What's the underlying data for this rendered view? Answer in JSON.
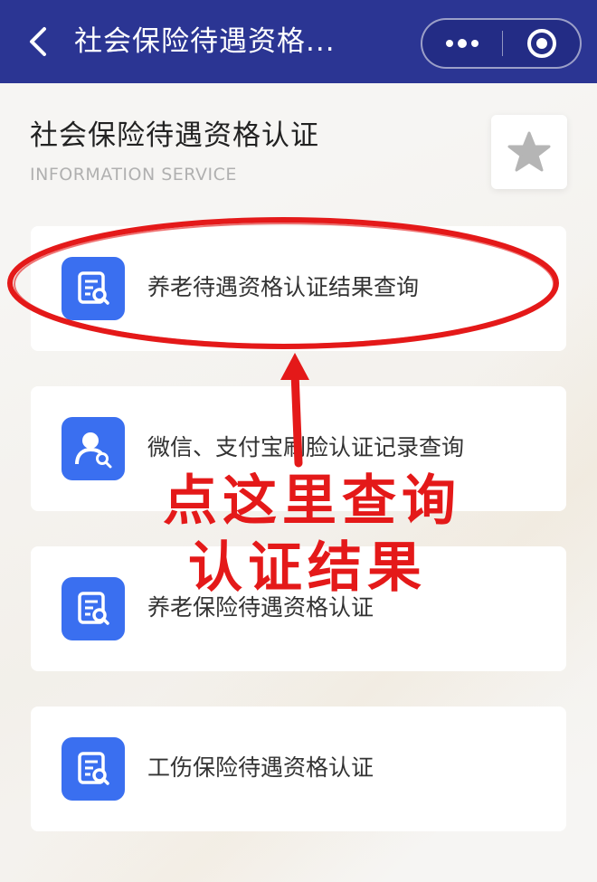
{
  "header": {
    "title": "社会保险待遇资格...",
    "back_icon": "chevron-left-icon",
    "more_icon": "more-dots-icon",
    "close_icon": "target-circle-icon",
    "background_color": "#2b3593"
  },
  "page": {
    "title": "社会保险待遇资格认证",
    "subtitle": "INFORMATION SERVICE",
    "favorite_icon": "star-icon"
  },
  "services": [
    {
      "label": "养老待遇资格认证结果查询",
      "icon": "document-search-icon"
    },
    {
      "label": "微信、支付宝刷脸认证记录查询",
      "icon": "user-search-icon"
    },
    {
      "label": "养老保险待遇资格认证",
      "icon": "document-search-icon"
    },
    {
      "label": "工伤保险待遇资格认证",
      "icon": "document-search-icon"
    }
  ],
  "annotation": {
    "line1": "点这里查询",
    "line2": "认证结果",
    "color": "#e41919"
  },
  "colors": {
    "accent": "#3a6ff0",
    "annotation": "#e41919"
  }
}
